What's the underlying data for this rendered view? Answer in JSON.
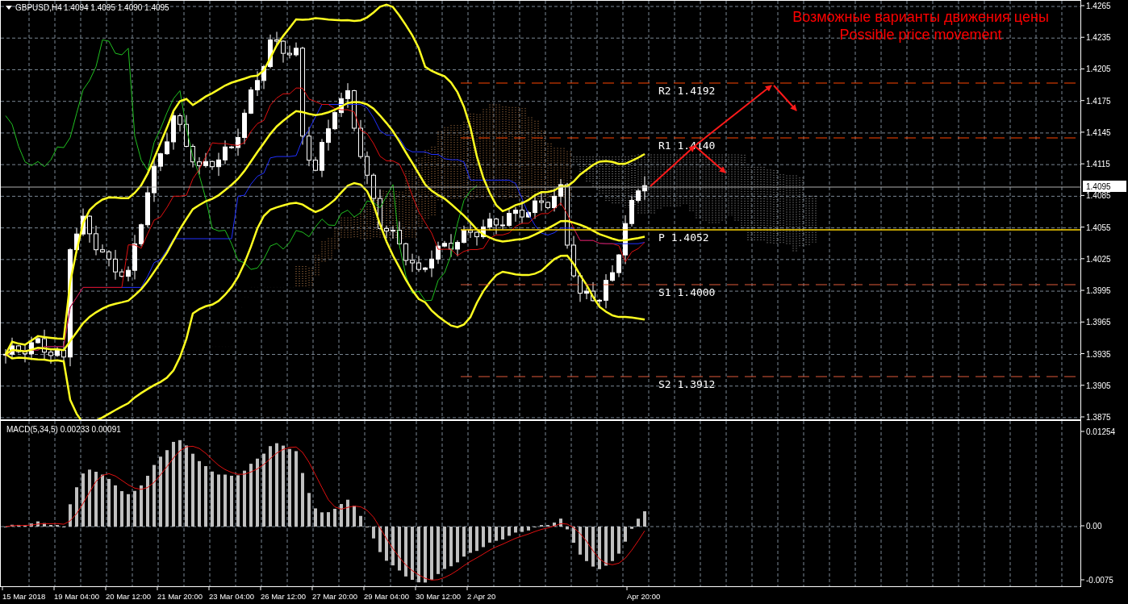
{
  "chart": {
    "symbol": "GBPUSD,H4",
    "quotes": [
      "1.4094",
      "1.4095",
      "1.4090",
      "1.4095"
    ],
    "annotation": [
      "Возможные варианты движения цены",
      "Possible price movement"
    ],
    "pivots": [
      {
        "kind": "resistance",
        "label": "R2 1.4192"
      },
      {
        "kind": "resistance",
        "label": "R1 1.4140"
      },
      {
        "kind": "pivot",
        "label": "P 1.4052"
      },
      {
        "kind": "support",
        "label": "S1 1.4000"
      },
      {
        "kind": "support",
        "label": "S2 1.3912"
      }
    ],
    "price_axis": [
      "1.4265",
      "1.4235",
      "1.4205",
      "1.4175",
      "1.4145",
      "1.4115",
      "1.4085",
      "1.4055",
      "1.4025",
      "1.3995",
      "1.3965",
      "1.3935",
      "1.3905",
      "1.3875"
    ],
    "current_price": "1.4095"
  },
  "macd": {
    "label": "MACD(5,34,5) 0.00233 0.00091",
    "axis": [
      "0.01254",
      "0.00",
      "-0.0075"
    ]
  },
  "time_axis": [
    "15 Mar 2018",
    "19 Mar 04:00",
    "20 Mar 12:00",
    "21 Mar 20:00",
    "23 Mar 04:00",
    "26 Mar 12:00",
    "27 Mar 20:00",
    "29 Mar 04:00",
    "30 Mar 12:00",
    "2 Apr 20",
    "Apr 20:00"
  ]
}
